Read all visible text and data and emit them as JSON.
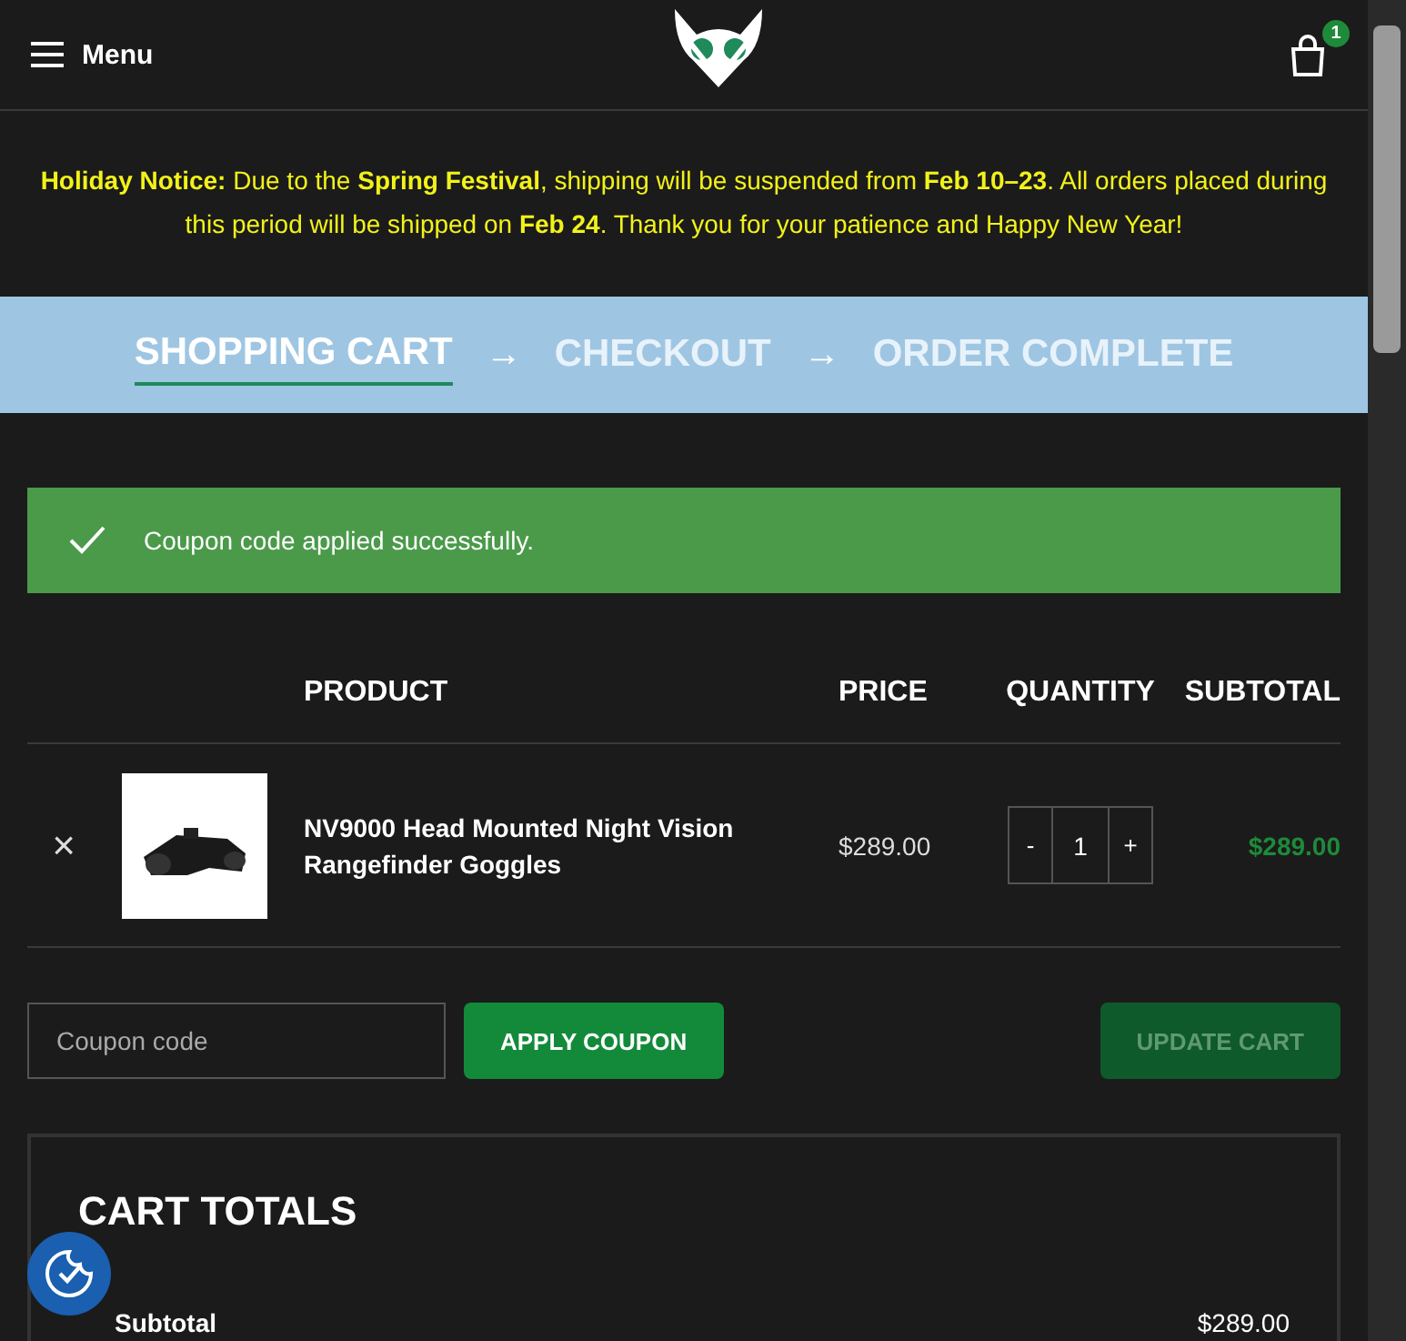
{
  "header": {
    "menu_label": "Menu",
    "cart_count": "1"
  },
  "notice": "**Holiday Notice:** Due to the **Spring Festival**, shipping will be suspended from **Feb 10–23**. All orders placed during this period will be shipped on **Feb 24**. Thank you for your patience and Happy New Year!",
  "steps": [
    {
      "label": "SHOPPING CART",
      "selected": true
    },
    {
      "label": "CHECKOUT",
      "selected": false
    },
    {
      "label": "ORDER COMPLETE",
      "selected": false
    }
  ],
  "step_separator": "→",
  "alert": {
    "message": "Coupon code applied successfully."
  },
  "table": {
    "columns": [
      "PRODUCT",
      "PRICE",
      "QUANTITY",
      "SUBTOTAL"
    ],
    "rows": [
      {
        "remove": "×",
        "product": "NV9000 Head Mounted Night Vision Rangefinder Goggles",
        "price": "$289.00",
        "quantity": "1",
        "decrement": "-",
        "increment": "+",
        "subtotal": "$289.00"
      }
    ]
  },
  "coupon": {
    "placeholder": "Coupon code",
    "apply_button": "APPLY COUPON",
    "update_button": "UPDATE CART",
    "update_disabled": true
  },
  "cart_totals": {
    "title": "CART TOTALS",
    "rows": [
      {
        "label": "Subtotal",
        "value": "$289.00"
      }
    ]
  }
}
